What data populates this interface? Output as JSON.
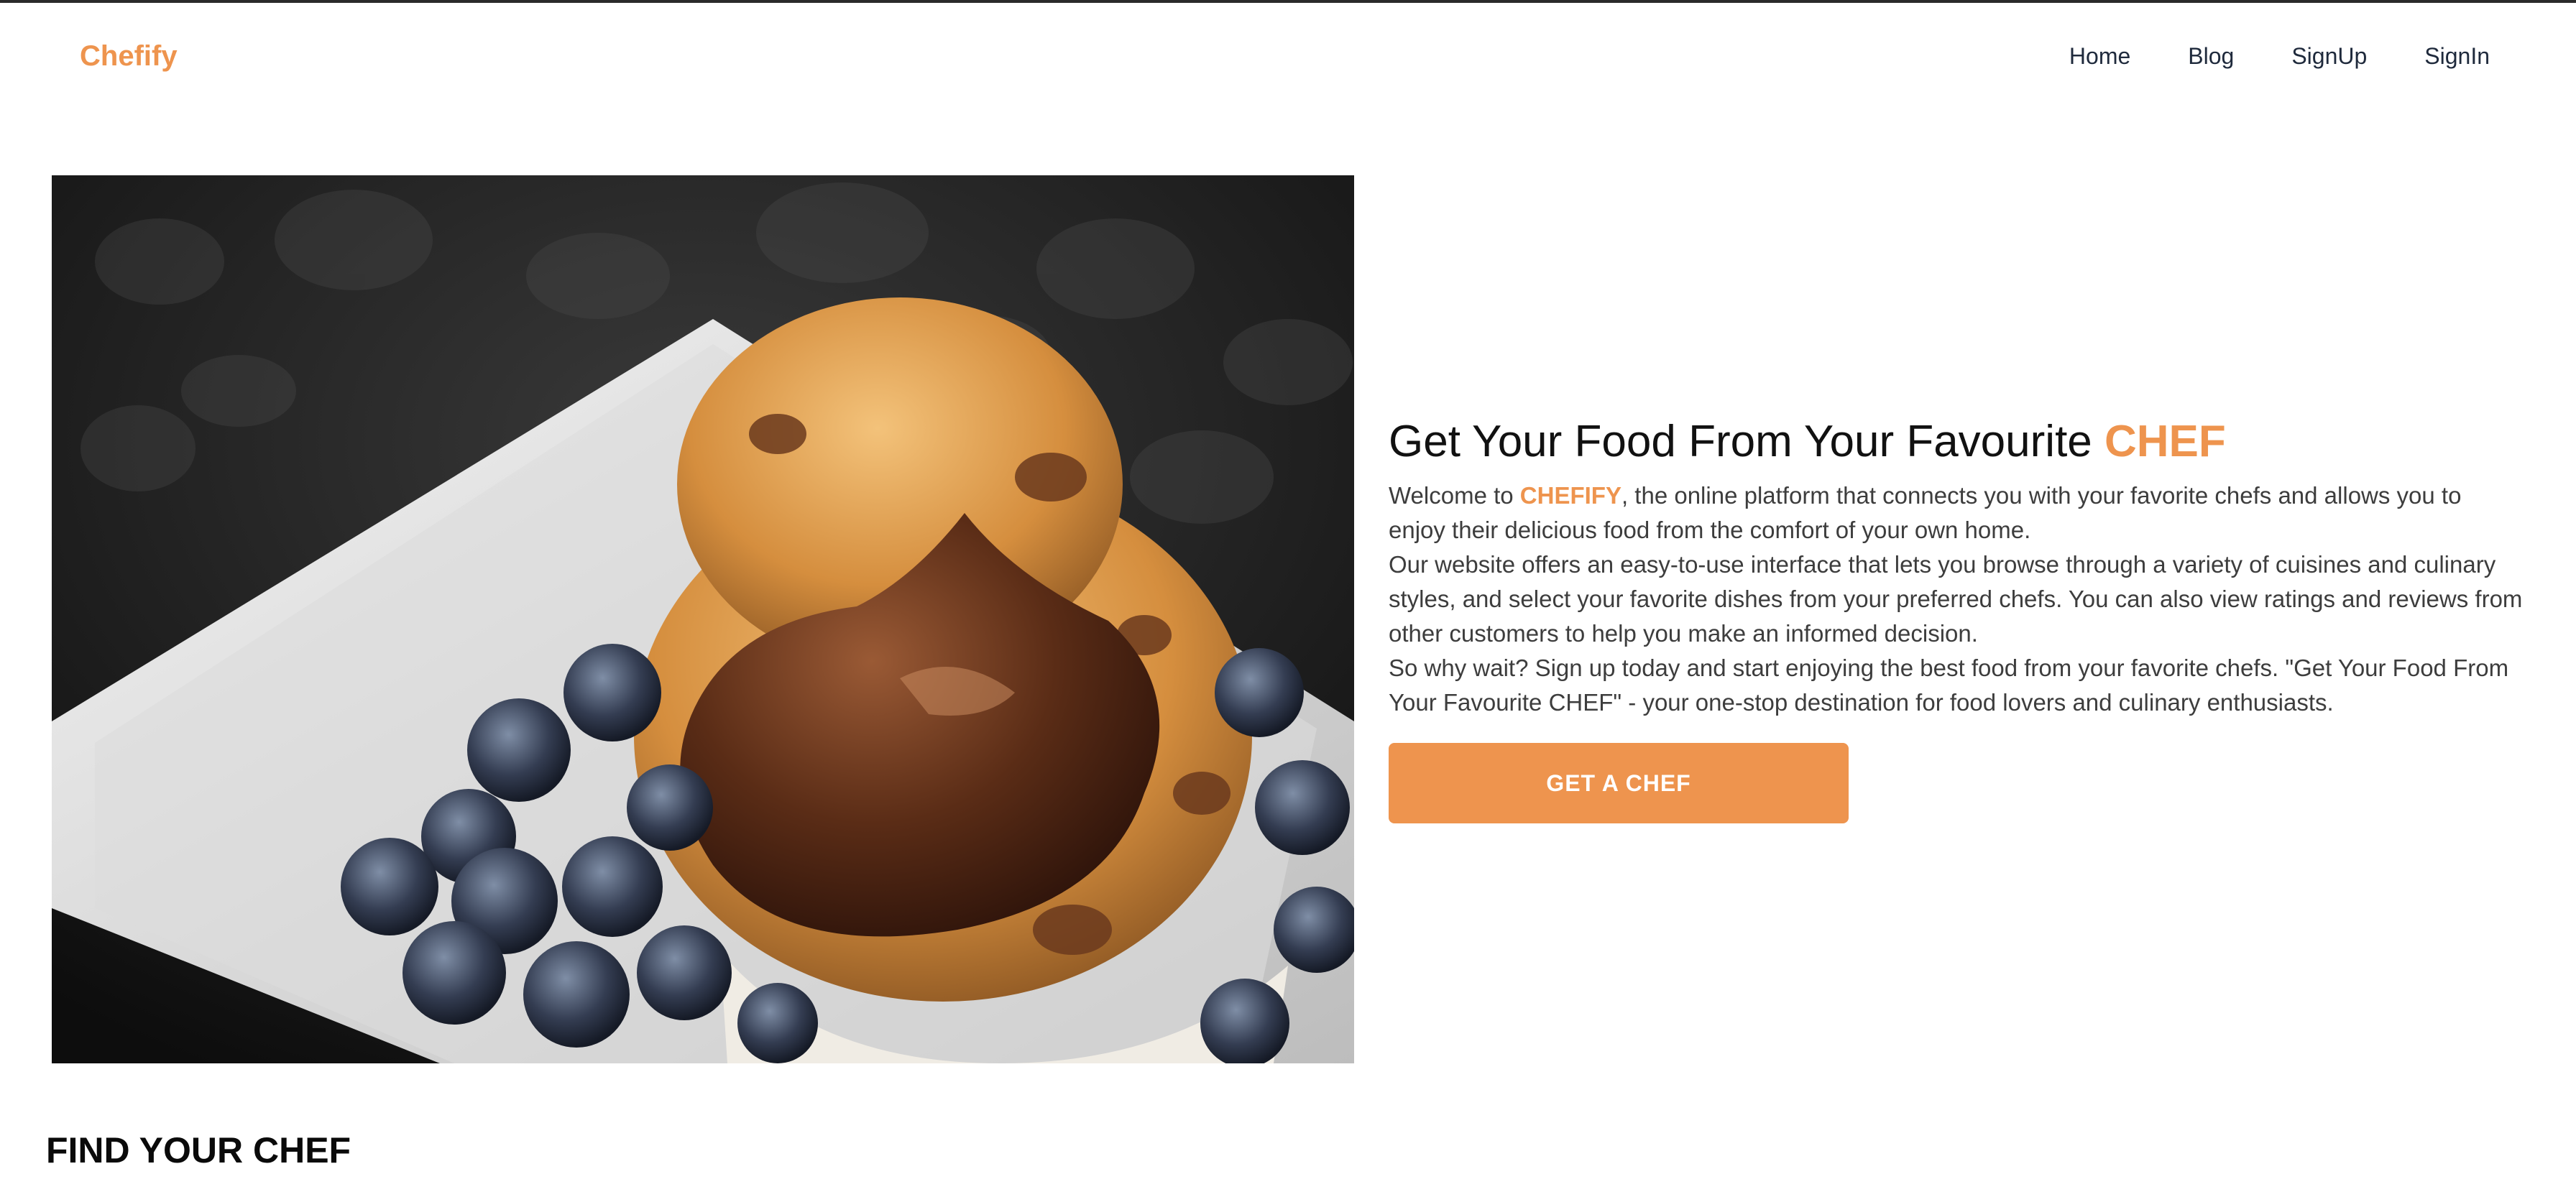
{
  "nav": {
    "brand": "Chefify",
    "links": [
      "Home",
      "Blog",
      "SignUp",
      "SignIn"
    ]
  },
  "hero": {
    "image_alt": "Chocolate-topped muffin with blueberries on a white plate",
    "title_main": "Get Your Food From Your Favourite ",
    "title_accent": "CHEF",
    "para1_before": "Welcome to ",
    "para1_accent": "CHEFIFY",
    "para1_after": ", the online platform that connects you with your favorite chefs and allows you to enjoy their delicious food from the comfort of your own home.",
    "para2": "Our website offers an easy-to-use interface that lets you browse through a variety of cuisines and culinary styles, and select your favorite dishes from your preferred chefs. You can also view ratings and reviews from other customers to help you make an informed decision.",
    "para3": "So why wait? Sign up today and start enjoying the best food from your favorite chefs. \"Get Your Food From Your Favourite CHEF\" - your one-stop destination for food lovers and culinary enthusiasts.",
    "cta_label": "GET A CHEF"
  },
  "section": {
    "title": "FIND YOUR CHEF"
  },
  "colors": {
    "accent": "#ee944e",
    "nav_text": "#1f2a3c",
    "body_text": "#3d3d3d"
  }
}
